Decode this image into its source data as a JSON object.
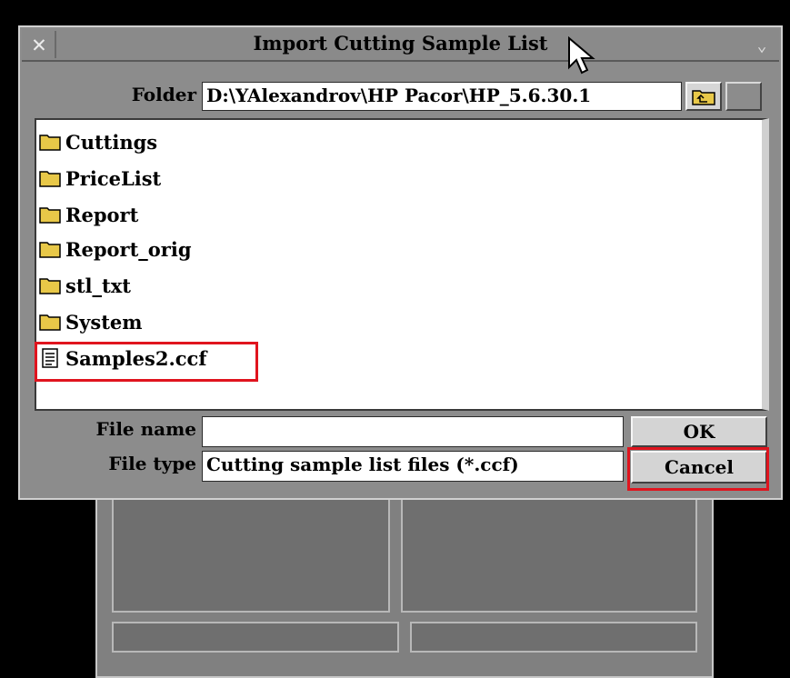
{
  "dialog": {
    "title": "Import Cutting Sample List",
    "close_glyph": "✕",
    "menu_glyph": "⌄"
  },
  "folder": {
    "label": "Folder",
    "path": "D:\\YAlexandrov\\HP Pacor\\HP_5.6.30.1"
  },
  "files": [
    {
      "name": "Cuttings",
      "icon": "folder-icon"
    },
    {
      "name": "PriceList",
      "icon": "folder-icon"
    },
    {
      "name": "Report",
      "icon": "folder-icon"
    },
    {
      "name": "Report_orig",
      "icon": "folder-icon"
    },
    {
      "name": "stl_txt",
      "icon": "folder-icon"
    },
    {
      "name": "System",
      "icon": "folder-icon"
    },
    {
      "name": "Samples2.ccf",
      "icon": "document-icon"
    }
  ],
  "filename": {
    "label": "File name",
    "value": ""
  },
  "filetype": {
    "label": "File type",
    "value": "Cutting sample list files (*.ccf)"
  },
  "buttons": {
    "ok": "OK",
    "cancel": "Cancel"
  },
  "colors": {
    "highlight": "#e0141e",
    "folder": "#e8c848"
  }
}
